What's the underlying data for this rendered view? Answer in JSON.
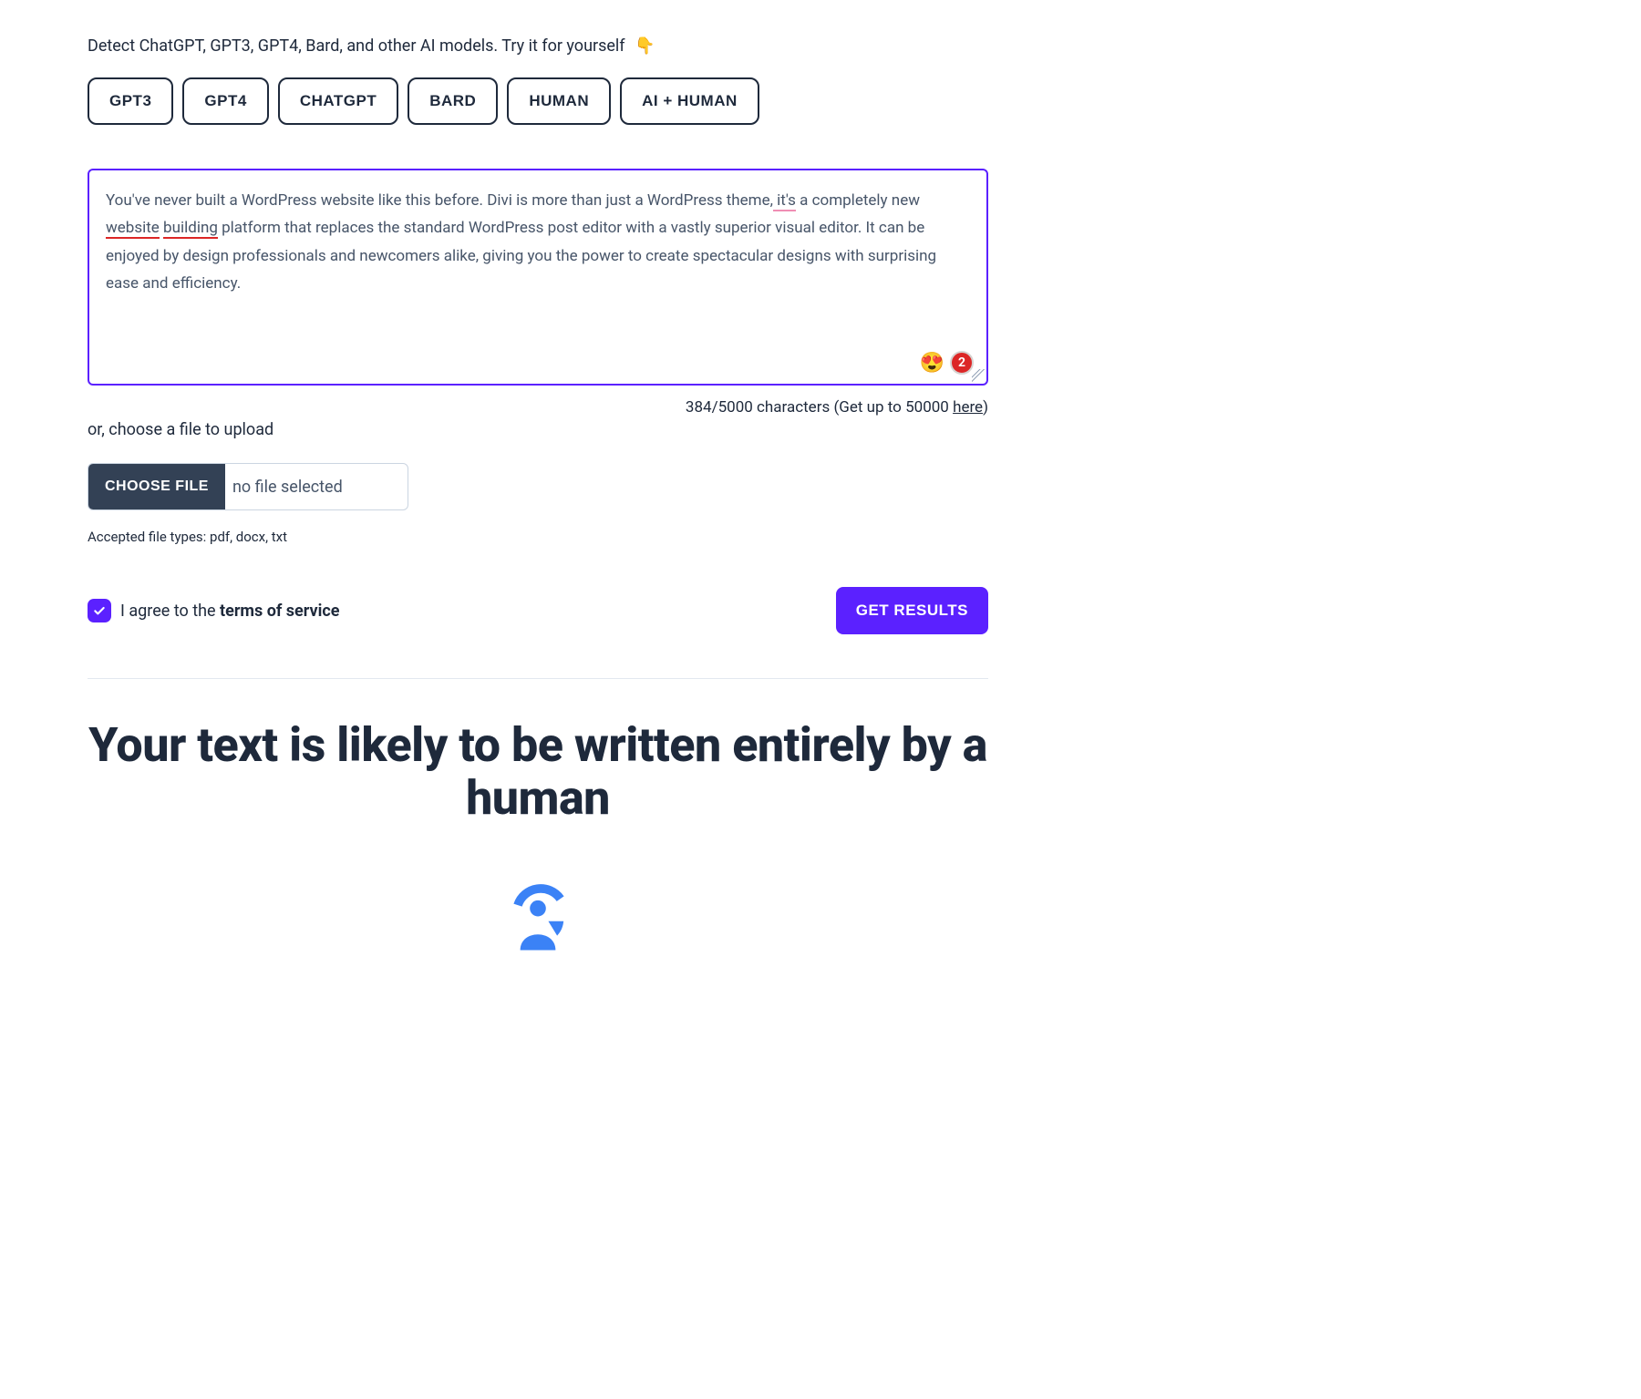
{
  "intro": {
    "text": "Detect ChatGPT, GPT3, GPT4, Bard, and other AI models. Try it for yourself",
    "emoji": "👇"
  },
  "model_buttons": [
    {
      "label": "GPT3"
    },
    {
      "label": "GPT4"
    },
    {
      "label": "CHATGPT"
    },
    {
      "label": "BARD"
    },
    {
      "label": "HUMAN"
    },
    {
      "label": "AI + HUMAN"
    }
  ],
  "textarea": {
    "content": "You've never built a WordPress website like this before. Divi is more than just a WordPress theme, it's a completely new website building platform that replaces the standard WordPress post editor with a vastly superior visual editor. It can be enjoyed by design professionals and newcomers alike, giving you the power to create spectacular designs with surprising ease and efficiency.",
    "reaction_emoji": "😍",
    "badge_count": "2"
  },
  "char_counter": {
    "current": "384",
    "max": "5000",
    "unit": "characters",
    "upsell_prefix": "(Get up to 50000 ",
    "upsell_link": "here",
    "upsell_suffix": ")"
  },
  "upload": {
    "hint": "or, choose a file to upload",
    "button_label": "CHOOSE FILE",
    "file_name": "no file selected",
    "accepted": "Accepted file types: pdf, docx, txt"
  },
  "agree": {
    "checked": true,
    "prefix": "I agree to the ",
    "tos": "terms of service"
  },
  "action": {
    "get_results": "GET RESULTS"
  },
  "result": {
    "heading": "Your text is likely to be written entirely by a human"
  }
}
